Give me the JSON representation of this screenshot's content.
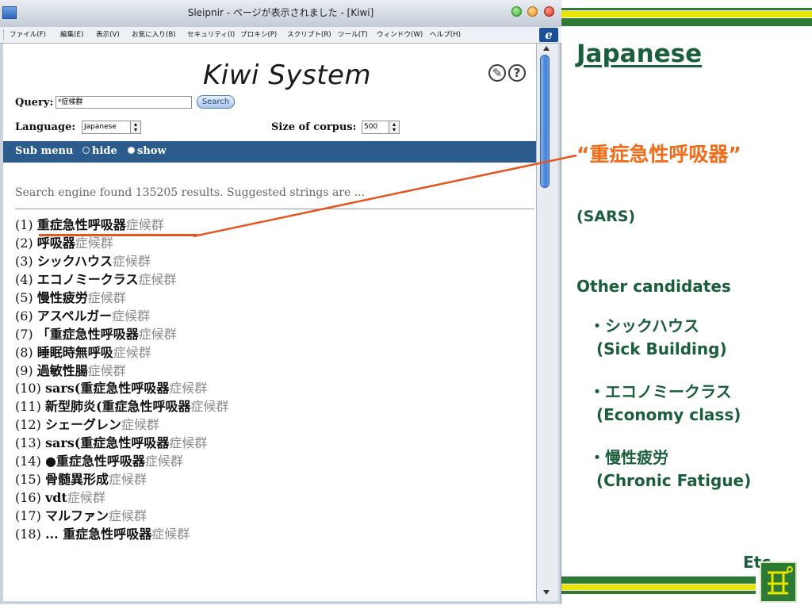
{
  "browser": {
    "title": "Sleipnir - ページが表示されました - [Kiwi]",
    "menu": [
      "ファイル(F)",
      "編集(E)",
      "表示(V)",
      "お気に入り(B)",
      "セキュリティ(I)",
      "プロキシ(P)",
      "スクリプト(R)",
      "ツール(T)",
      "ウィンドウ(W)",
      "ヘルプ(H)"
    ],
    "ie_glyph": "e"
  },
  "page": {
    "heading": "Kiwi System",
    "edit_glyph": "✎",
    "help_glyph": "?",
    "query_label": "Query:",
    "query_value": "*症候群",
    "search_label": "Search",
    "language_label": "Language:",
    "language_value": "Japanese",
    "corpus_label": "Size of corpus:",
    "corpus_value": "500",
    "submenu_label": "Sub menu",
    "hide_label": "hide",
    "show_label": "show",
    "found_text": "Search engine found 135205 results. Suggested strings are ...",
    "results": [
      {
        "num": "(1)",
        "term": "重症急性呼吸器",
        "suffix": "症候群"
      },
      {
        "num": "(2)",
        "term": "呼吸器",
        "suffix": "症候群"
      },
      {
        "num": "(3)",
        "term": "シックハウス",
        "suffix": "症候群"
      },
      {
        "num": "(4)",
        "term": "エコノミークラス",
        "suffix": "症候群"
      },
      {
        "num": "(5)",
        "term": "慢性疲労",
        "suffix": "症候群"
      },
      {
        "num": "(6)",
        "term": "アスペルガー",
        "suffix": "症候群"
      },
      {
        "num": "(7)",
        "term": "「重症急性呼吸器",
        "suffix": "症候群"
      },
      {
        "num": "(8)",
        "term": "睡眠時無呼吸",
        "suffix": "症候群"
      },
      {
        "num": "(9)",
        "term": "過敏性腸",
        "suffix": "症候群"
      },
      {
        "num": "(10)",
        "term": "sars(重症急性呼吸器",
        "suffix": "症候群"
      },
      {
        "num": "(11)",
        "term": "新型肺炎(重症急性呼吸器",
        "suffix": "症候群"
      },
      {
        "num": "(12)",
        "term": "シェーグレン",
        "suffix": "症候群"
      },
      {
        "num": "(13)",
        "term": "sars(重症急性呼吸器",
        "suffix": "症候群"
      },
      {
        "num": "(14)",
        "term": "●重症急性呼吸器",
        "suffix": "症候群"
      },
      {
        "num": "(15)",
        "term": "骨髄異形成",
        "suffix": "症候群"
      },
      {
        "num": "(16)",
        "term": "vdt",
        "suffix": "症候群"
      },
      {
        "num": "(17)",
        "term": "マルファン",
        "suffix": "症候群"
      },
      {
        "num": "(18)",
        "term": "... 重症急性呼吸器",
        "suffix": "症候群"
      }
    ]
  },
  "slide": {
    "title": "Japanese",
    "term_jp": "“重症急性呼吸器”",
    "term_en": "(SARS)",
    "other_title": "Other candidates",
    "candidates": [
      {
        "jp": "・シックハウス",
        "en": "(Sick Building)"
      },
      {
        "jp": "・エコノミークラス",
        "en": "(Economy class)"
      },
      {
        "jp": "・慢性疲労",
        "en": "(Chronic Fatigue)"
      }
    ],
    "etc": "Etc.",
    "colors": {
      "accent_orange": "#f06b1a",
      "title_green": "#1a5e3c",
      "stripe_green": "#2d7a35",
      "stripe_yellow": "#e8e600"
    }
  }
}
